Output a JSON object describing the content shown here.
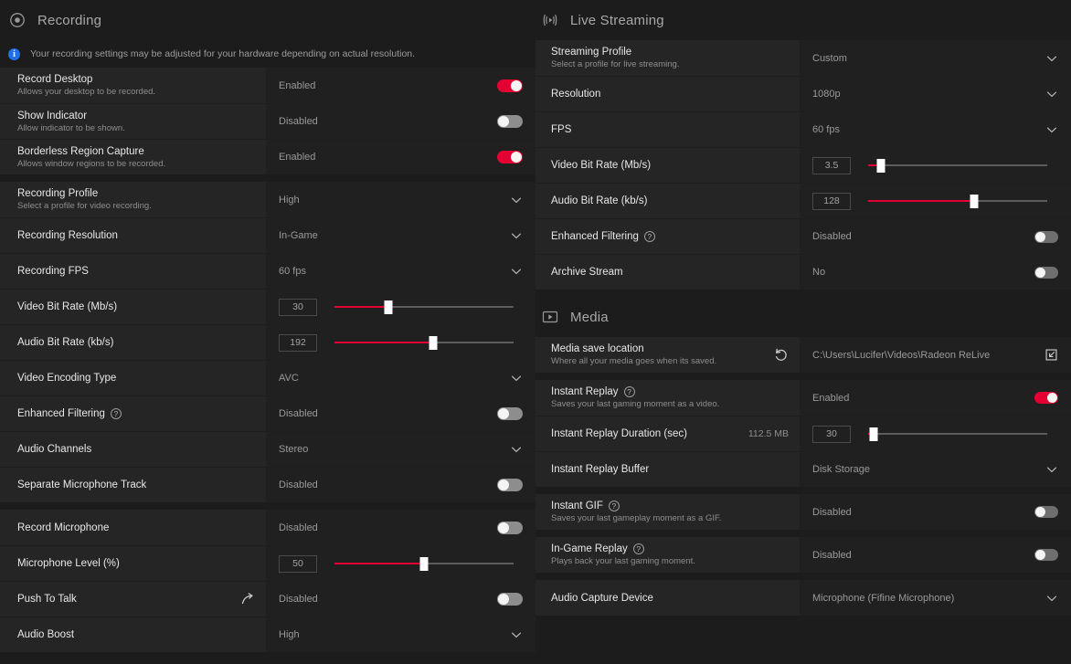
{
  "theme": {
    "bg": "#1c1c1c",
    "row_label_bg": "#252525",
    "row_value_bg": "#202020",
    "accent_red": "#e40033",
    "info_blue": "#1f6feb",
    "text_primary": "#e8e8e8",
    "text_secondary": "#8e8e8e",
    "text_value": "#9a9a9a"
  },
  "left_panel": {
    "section": {
      "title": "Recording",
      "icon": "record-circle-icon"
    },
    "banner": {
      "icon": "info-icon",
      "text": "Your recording settings may be adjusted for your hardware depending on actual resolution."
    },
    "groups": [
      {
        "rows": [
          {
            "name": "record-desktop",
            "label": "Record Desktop",
            "sub": "Allows your desktop to be recorded.",
            "control": "toggle",
            "value": "Enabled",
            "on": true
          },
          {
            "name": "show-indicator",
            "label": "Show Indicator",
            "sub": "Allow indicator to be shown.",
            "control": "toggle",
            "value": "Disabled",
            "on": false
          },
          {
            "name": "borderless-region-capture",
            "label": "Borderless Region Capture",
            "sub": "Allows window regions to be recorded.",
            "control": "toggle",
            "value": "Enabled",
            "on": true
          }
        ]
      },
      {
        "rows": [
          {
            "name": "recording-profile",
            "label": "Recording Profile",
            "sub": "Select a profile for video recording.",
            "control": "dropdown",
            "value": "High"
          },
          {
            "name": "recording-resolution",
            "label": "Recording Resolution",
            "control": "dropdown",
            "value": "In-Game"
          },
          {
            "name": "recording-fps",
            "label": "Recording FPS",
            "control": "dropdown",
            "value": "60 fps"
          },
          {
            "name": "video-bit-rate",
            "label": "Video Bit Rate (Mb/s)",
            "control": "slider",
            "value": "30",
            "percent": 30
          },
          {
            "name": "audio-bit-rate",
            "label": "Audio Bit Rate (kb/s)",
            "control": "slider",
            "value": "192",
            "percent": 55
          },
          {
            "name": "video-encoding-type",
            "label": "Video Encoding Type",
            "control": "dropdown",
            "value": "AVC"
          },
          {
            "name": "enhanced-filtering",
            "label": "Enhanced Filtering",
            "help_icon": "question-mark-icon",
            "control": "toggle",
            "value": "Disabled",
            "on": false
          },
          {
            "name": "audio-channels",
            "label": "Audio Channels",
            "control": "dropdown",
            "value": "Stereo"
          },
          {
            "name": "separate-microphone-track",
            "label": "Separate Microphone Track",
            "control": "toggle",
            "value": "Disabled",
            "on": false
          }
        ]
      },
      {
        "rows": [
          {
            "name": "record-microphone",
            "label": "Record Microphone",
            "control": "toggle",
            "value": "Disabled",
            "on": false
          },
          {
            "name": "microphone-level",
            "label": "Microphone Level (%)",
            "control": "slider",
            "value": "50",
            "percent": 50
          },
          {
            "name": "push-to-talk",
            "label": "Push To Talk",
            "trail_icon": "shortcut-arrow-icon",
            "control": "toggle",
            "value": "Disabled",
            "on": false
          },
          {
            "name": "audio-boost",
            "label": "Audio Boost",
            "control": "dropdown",
            "value": "High"
          }
        ]
      }
    ]
  },
  "right_panel": {
    "sections": [
      {
        "name": "live-streaming",
        "title": "Live Streaming",
        "icon": "broadcast-icon",
        "groups": [
          {
            "rows": [
              {
                "name": "streaming-profile",
                "label": "Streaming Profile",
                "sub": "Select a profile for live streaming.",
                "control": "dropdown",
                "value": "Custom"
              },
              {
                "name": "stream-resolution",
                "label": "Resolution",
                "control": "dropdown",
                "value": "1080p"
              },
              {
                "name": "stream-fps",
                "label": "FPS",
                "control": "dropdown",
                "value": "60 fps"
              },
              {
                "name": "stream-video-bit-rate",
                "label": "Video Bit Rate (Mb/s)",
                "control": "slider",
                "value": "3.5",
                "percent": 7
              },
              {
                "name": "stream-audio-bit-rate",
                "label": "Audio Bit Rate (kb/s)",
                "control": "slider",
                "value": "128",
                "percent": 59
              },
              {
                "name": "stream-enhanced-filtering",
                "label": "Enhanced Filtering",
                "help_icon": "question-mark-icon",
                "control": "toggle-small",
                "value": "Disabled",
                "on": false
              },
              {
                "name": "archive-stream",
                "label": "Archive Stream",
                "control": "toggle-small",
                "value": "No",
                "on": false
              }
            ]
          }
        ]
      },
      {
        "name": "media",
        "title": "Media",
        "icon": "media-play-icon",
        "groups": [
          {
            "rows": [
              {
                "name": "media-save-location",
                "label": "Media save location",
                "sub": "Where all your media goes when its saved.",
                "trail_icon": "reset-icon",
                "control": "path",
                "value": "C:\\Users\\Lucifer\\Videos\\Radeon ReLive",
                "action_icon": "browse-folder-icon"
              }
            ]
          },
          {
            "rows": [
              {
                "name": "instant-replay",
                "label": "Instant Replay",
                "help_icon": "question-mark-icon",
                "sub": "Saves your last gaming moment as a video.",
                "control": "toggle-small",
                "value": "Enabled",
                "on": true
              },
              {
                "name": "instant-replay-duration",
                "label": "Instant Replay Duration (sec)",
                "side_note": "112.5 MB",
                "control": "slider",
                "value": "30",
                "percent": 3
              },
              {
                "name": "instant-replay-buffer",
                "label": "Instant Replay Buffer",
                "control": "dropdown",
                "value": "Disk Storage"
              }
            ]
          },
          {
            "rows": [
              {
                "name": "instant-gif",
                "label": "Instant GIF",
                "help_icon": "question-mark-icon",
                "sub": "Saves your last gameplay moment as a GIF.",
                "control": "toggle-small",
                "value": "Disabled",
                "on": false
              }
            ]
          },
          {
            "rows": [
              {
                "name": "in-game-replay",
                "label": "In-Game Replay",
                "help_icon": "question-mark-icon",
                "sub": "Plays back your last gaming moment.",
                "control": "toggle-small",
                "value": "Disabled",
                "on": false
              }
            ]
          },
          {
            "rows": [
              {
                "name": "audio-capture-device",
                "label": "Audio Capture Device",
                "control": "dropdown",
                "value": "Microphone (Fifine Microphone)"
              }
            ]
          }
        ]
      }
    ]
  }
}
